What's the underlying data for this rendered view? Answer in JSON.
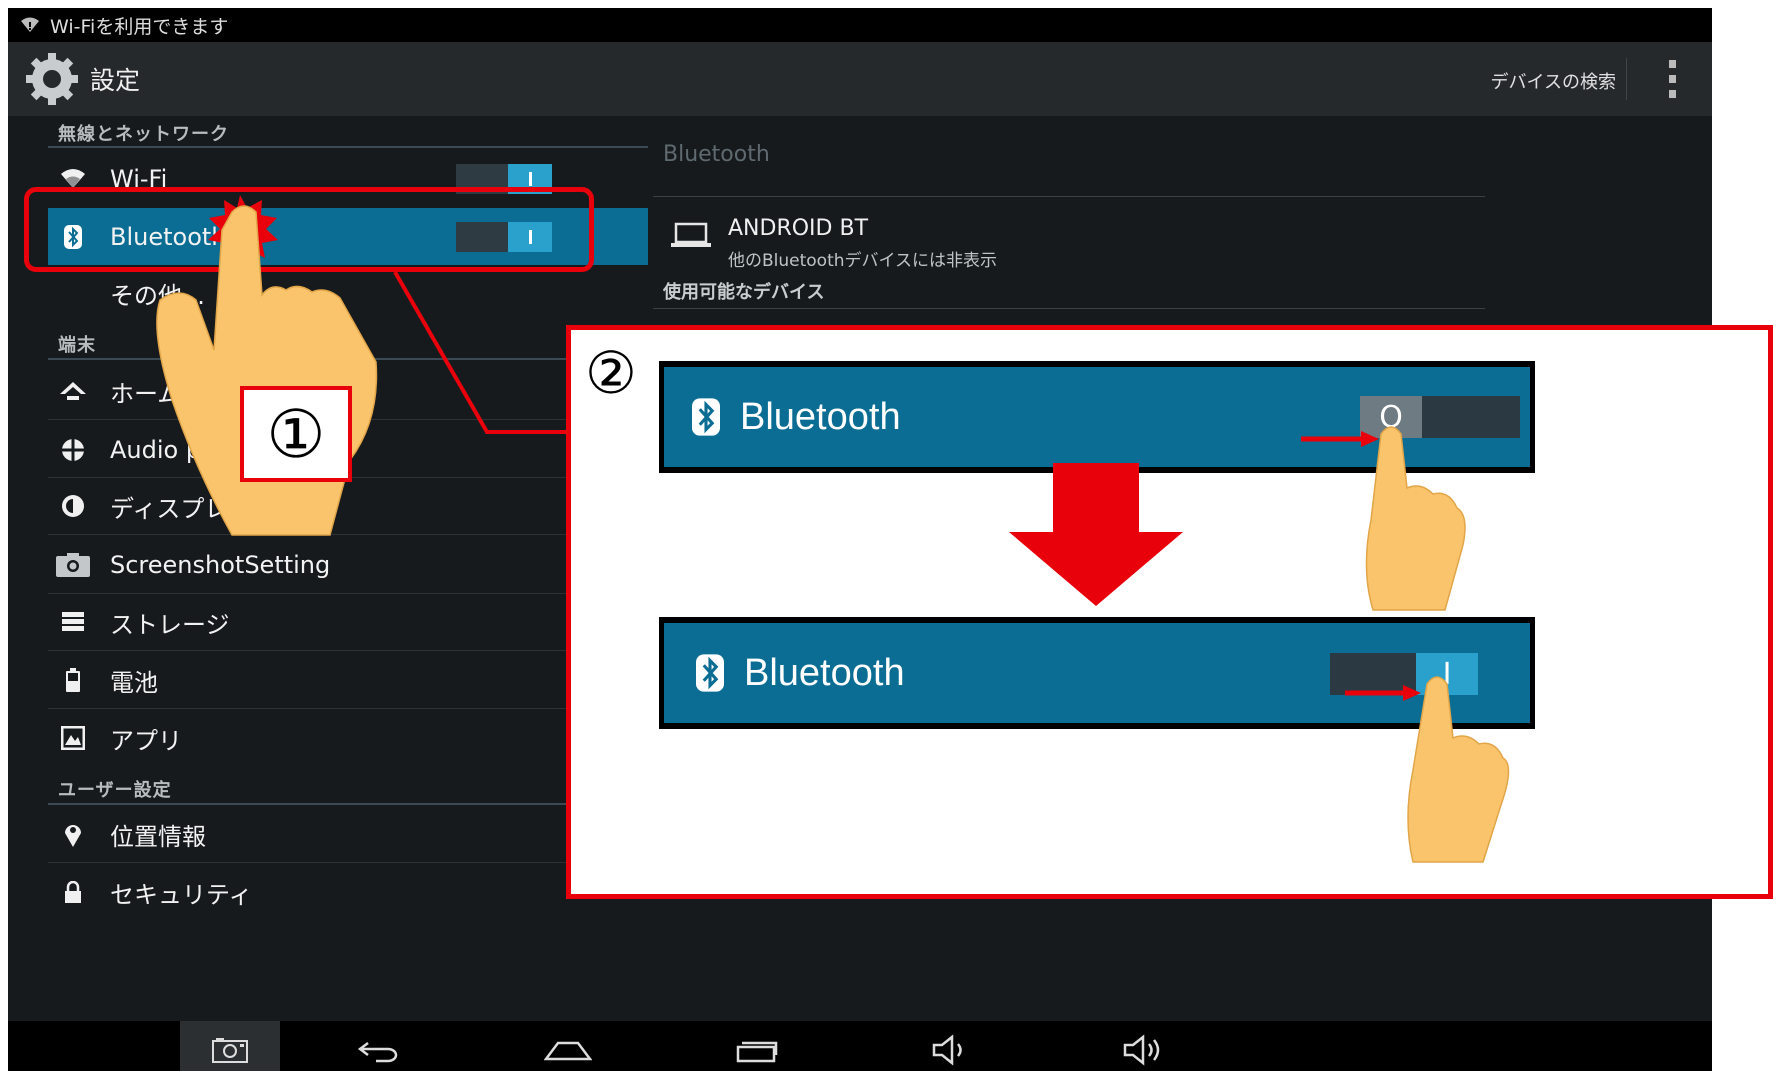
{
  "status_bar": {
    "text": "Wi-Fiを利用できます"
  },
  "action_bar": {
    "title": "設定",
    "search_devices": "デバイスの検索"
  },
  "sections": {
    "wireless": "無線とネットワーク",
    "device": "端末",
    "user": "ユーザー設定"
  },
  "items": {
    "wifi": "Wi-Fi",
    "bluetooth": "Bluetooth",
    "more": "その他...",
    "home": "ホーム",
    "audio": "Audio profi",
    "display": "ディスプレイ",
    "screenshot": "ScreenshotSetting",
    "storage": "ストレージ",
    "battery": "電池",
    "apps": "アプリ",
    "location": "位置情報",
    "security": "セキュリティ"
  },
  "right_pane": {
    "title": "Bluetooth",
    "device_name": "ANDROID BT",
    "device_sub": "他のBluetoothデバイスには非表示",
    "available": "使用可能なデバイス"
  },
  "annotation": {
    "step1": "①",
    "step2": "②",
    "bt_label_before": "Bluetooth",
    "bt_label_after": "Bluetooth",
    "toggle_off_glyph": "O",
    "toggle_on_glyph": "I"
  },
  "colors": {
    "accent": "#0b6d93",
    "switch_on": "#2aa0cc",
    "callout_red": "#e8000b",
    "hand": "#f9c46b"
  },
  "toggles": {
    "wifi_on": true,
    "bluetooth_on": true
  }
}
